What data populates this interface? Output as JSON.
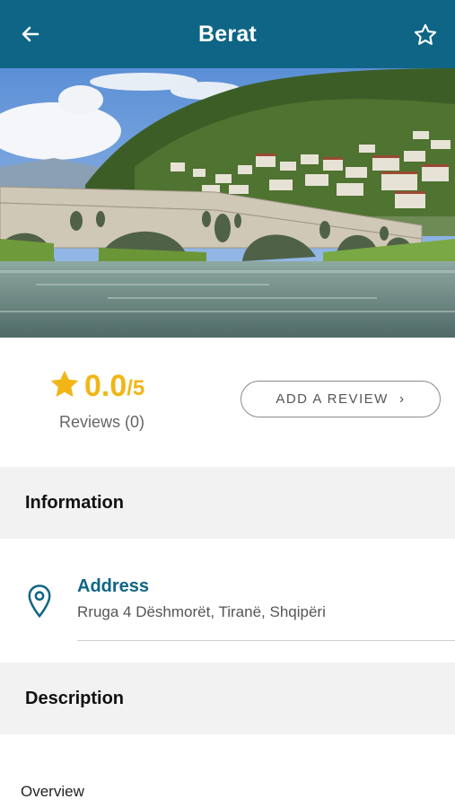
{
  "header": {
    "title": "Berat",
    "back_icon": "arrow-left-icon",
    "favorite_icon": "star-outline-icon",
    "background": "#0e6585"
  },
  "hero": {
    "alt": "stone arch bridge over river with hillside town"
  },
  "rating": {
    "score": "0.0",
    "max": "/5",
    "star_icon": "star-icon",
    "reviews_label": "Reviews (0)",
    "accent": "#f1b616"
  },
  "review_button": {
    "label": "ADD A REVIEW",
    "chevron": "›"
  },
  "information": {
    "heading": "Information",
    "address_title": "Address",
    "address_value": "Rruga 4 Dëshmorët, Tiranë, Shqipëri",
    "pin_icon": "location-pin-icon"
  },
  "description": {
    "heading": "Description",
    "overview_label": "Overview"
  }
}
